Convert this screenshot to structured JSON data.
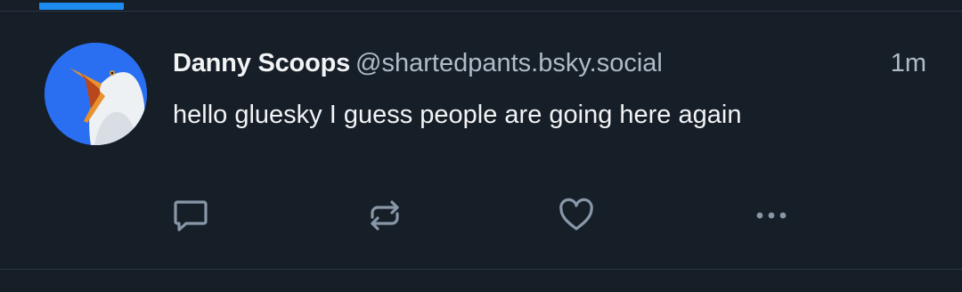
{
  "feed": {
    "active_tab_color": "#1d8cf0"
  },
  "post": {
    "author": {
      "display_name": "Danny Scoops",
      "handle": "@shartedpants.bsky.social",
      "avatar": "seagull-avatar"
    },
    "timestamp": "1m",
    "text": "hello gluesky I guess people are going here again",
    "actions": [
      {
        "name": "reply",
        "icon": "speech-bubble-icon"
      },
      {
        "name": "repost",
        "icon": "repost-arrows-icon"
      },
      {
        "name": "like",
        "icon": "heart-icon"
      },
      {
        "name": "more",
        "icon": "ellipsis-icon"
      }
    ]
  },
  "colors": {
    "background": "#161e27",
    "divider": "#2b3541",
    "text_primary": "#f1f3f5",
    "text_secondary": "#aebbc9",
    "icon": "#8897a8",
    "avatar_bg": "#2a6ff2"
  }
}
